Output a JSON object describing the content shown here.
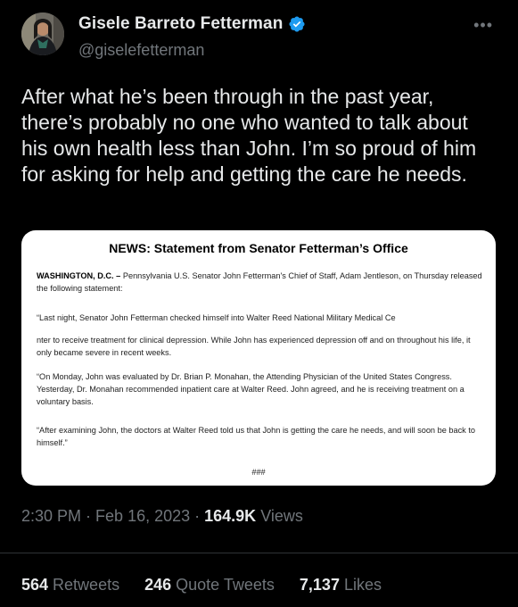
{
  "author": {
    "name": "Gisele Barreto Fetterman",
    "handle": "@giselefetterman"
  },
  "icons": {
    "verified": "verified-badge-icon",
    "more": "more-options-icon"
  },
  "colors": {
    "background": "#000000",
    "text": "#e7e9ea",
    "secondary": "#71767b",
    "verified": "#1d9bf0",
    "divider": "#2f3336"
  },
  "more_label": "•••",
  "tweet": {
    "text": "After what he’s been through in the past year, there’s probably no one who wanted to talk about his own health less than John. I’m so proud of him for asking for help and getting the care he needs."
  },
  "media": {
    "title": "NEWS: Statement from Senator Fetterman’s Office",
    "dateline": "WASHINGTON, D.C. –",
    "p1": "Pennsylvania U.S. Senator John Fetterman's Chief of Staff, Adam Jentleson, on Thursday released the following statement:",
    "p2": "“Last night, Senator John Fetterman checked himself into Walter Reed National Military Medical Ce",
    "p3": "nter to receive treatment for clinical depression. While John has experienced depression off and on throughout his life, it only became severe in recent weeks.",
    "p4": "“On Monday, John was evaluated by Dr. Brian P. Monahan, the Attending Physician of the United States Congress. Yesterday, Dr. Monahan recommended inpatient care at Walter Reed. John agreed, and he is receiving treatment on a voluntary basis.",
    "p5": "“After examining John, the doctors at Walter Reed told us that John is getting the care he needs, and will soon be back to himself.”",
    "end_mark": "###"
  },
  "meta": {
    "time": "2:30 PM",
    "sep1": " · ",
    "date": "Feb 16, 2023",
    "sep2": " · ",
    "views_count": "164.9K",
    "views_label": " Views"
  },
  "stats": {
    "retweets_count": "564",
    "retweets_label": " Retweets",
    "quotes_count": "246",
    "quotes_label": " Quote Tweets",
    "likes_count": "7,137",
    "likes_label": " Likes"
  }
}
